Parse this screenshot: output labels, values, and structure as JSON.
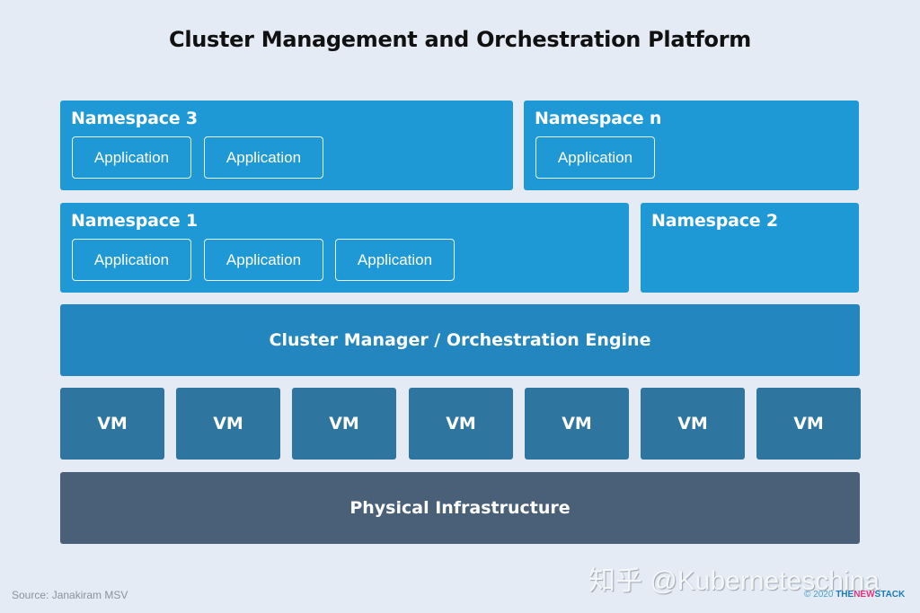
{
  "title": "Cluster Management and Orchestration Platform",
  "namespaces": [
    {
      "label": "Namespace 3",
      "applications": [
        "Application",
        "Application"
      ]
    },
    {
      "label": "Namespace n",
      "applications": [
        "Application"
      ]
    },
    {
      "label": "Namespace 1",
      "applications": [
        "Application",
        "Application",
        "Application"
      ]
    },
    {
      "label": "Namespace 2",
      "applications": []
    }
  ],
  "engine": {
    "label": "Cluster Manager / Orchestration Engine"
  },
  "vms": [
    "VM",
    "VM",
    "VM",
    "VM",
    "VM",
    "VM",
    "VM"
  ],
  "infrastructure": {
    "label": "Physical Infrastructure"
  },
  "footer": {
    "source": "Source: Janakiram MSV",
    "watermark": "知乎 @Kuberneteschina",
    "copyright": "© 2020",
    "brand_the": "THE",
    "brand_new": "NEW",
    "brand_stack": "STACK"
  },
  "colors": {
    "namespace": "#1f99d5",
    "engine": "#2386be",
    "vm": "#2e76a0",
    "infrastructure": "#4a6078",
    "background": "#e4ebf4"
  }
}
